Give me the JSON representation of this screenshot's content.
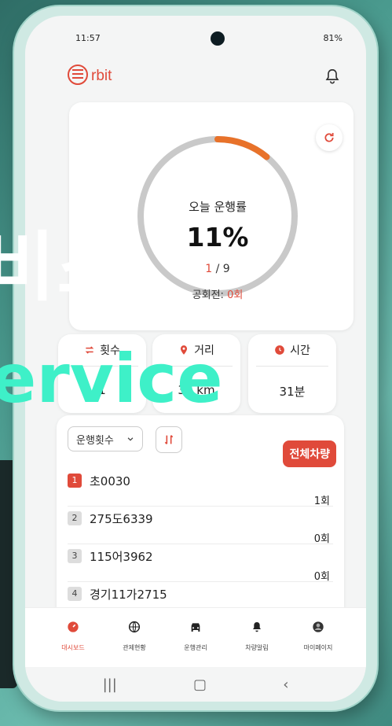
{
  "status": {
    "time": "11:57",
    "battery": "81%"
  },
  "app": {
    "logo_text": "rbit"
  },
  "rate": {
    "label": "오늘 운행률",
    "percent_text": "11%",
    "percent": 11,
    "running": "1",
    "total": "/ 9",
    "empty_label": "공회전:",
    "empty_value": "0회"
  },
  "stats": [
    {
      "label": "횟수",
      "value": "1"
    },
    {
      "label": "거리",
      "value": "32 km"
    },
    {
      "label": "시간",
      "value": "31분"
    }
  ],
  "overlay": {
    "line1": "비스",
    "line2": "ervice"
  },
  "list": {
    "dropdown_value": "운행횟수",
    "all_button": "전체차량",
    "rows": [
      {
        "index": "1",
        "plate": "초0030",
        "count": "1회"
      },
      {
        "index": "2",
        "plate": "275도6339",
        "count": "0회"
      },
      {
        "index": "3",
        "plate": "115어3962",
        "count": "0회"
      },
      {
        "index": "4",
        "plate": "경기11가2715",
        "count": "0회"
      }
    ]
  },
  "tabs": [
    {
      "label": "대시보드",
      "icon": "dashboard-icon"
    },
    {
      "label": "관제현황",
      "icon": "globe-icon"
    },
    {
      "label": "운행관리",
      "icon": "car-icon"
    },
    {
      "label": "차량알림",
      "icon": "bell-icon"
    },
    {
      "label": "마이페이지",
      "icon": "user-icon"
    }
  ],
  "colors": {
    "accent": "#e04a3a",
    "ring_progress": "#e8722a",
    "ring_track": "#c9c9c9"
  }
}
